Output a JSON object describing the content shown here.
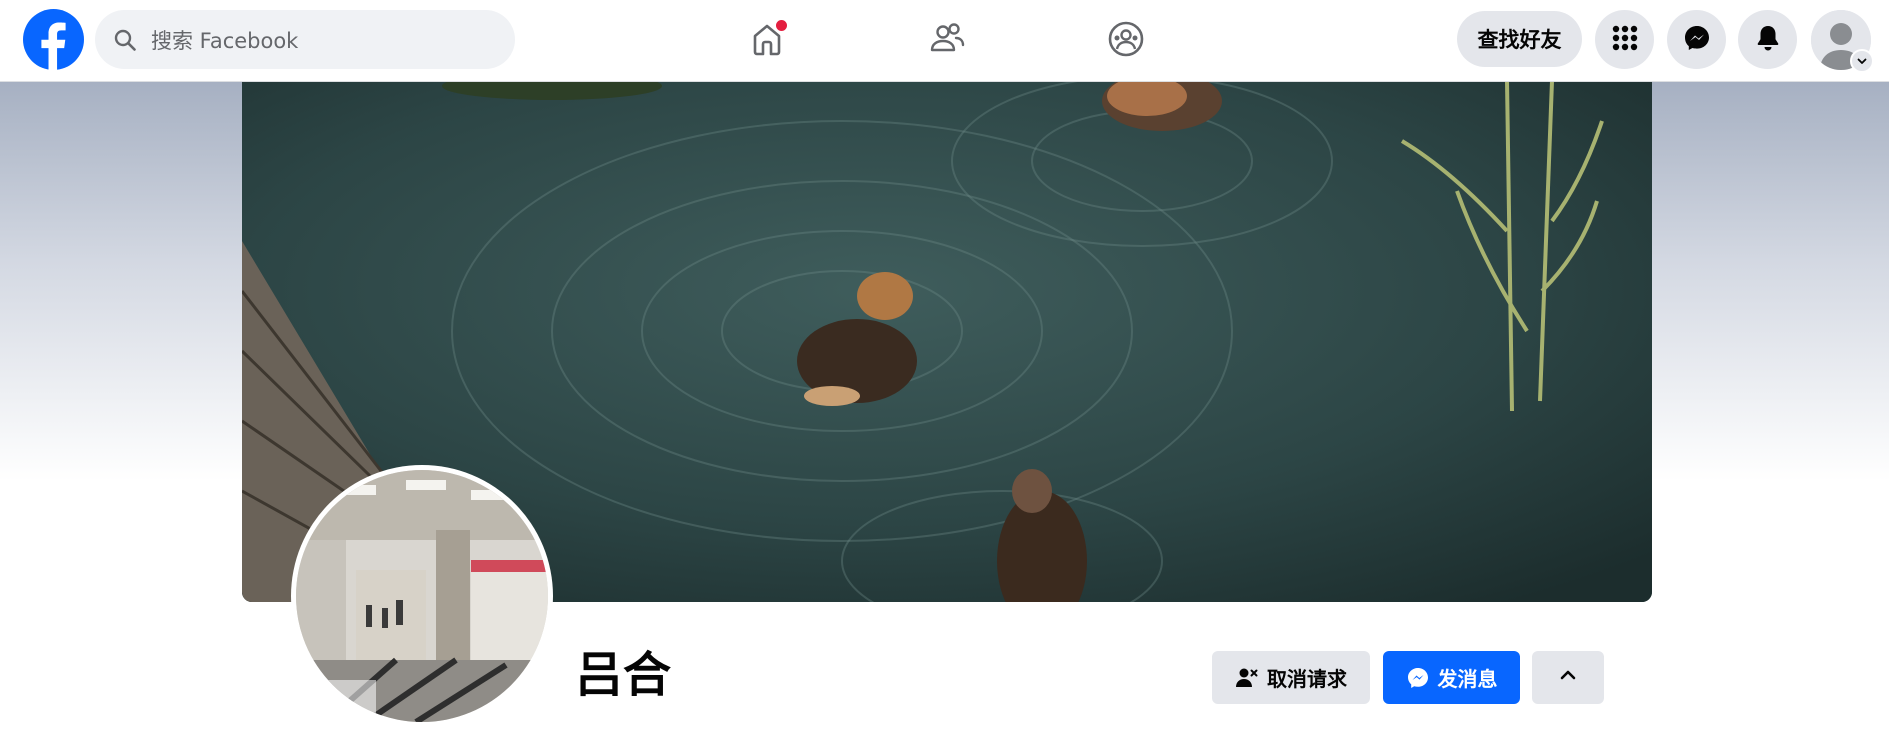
{
  "header": {
    "search": {
      "placeholder": "搜索 Facebook"
    },
    "find_friends_label": "查找好友",
    "icons": {
      "logo": "facebook-logo-icon",
      "home": "home-icon",
      "friends": "friends-icon",
      "groups": "groups-icon",
      "menu": "apps-grid-icon",
      "messenger": "messenger-icon",
      "notifications": "bell-icon",
      "account": "avatar-icon"
    },
    "home_has_notification": true
  },
  "profile": {
    "name": "吕合",
    "actions": {
      "cancel_request_label": "取消请求",
      "message_label": "发消息"
    }
  },
  "colors": {
    "brand": "#0866ff",
    "notification_dot": "#e41e3f",
    "button_gray": "#e4e6eb"
  }
}
